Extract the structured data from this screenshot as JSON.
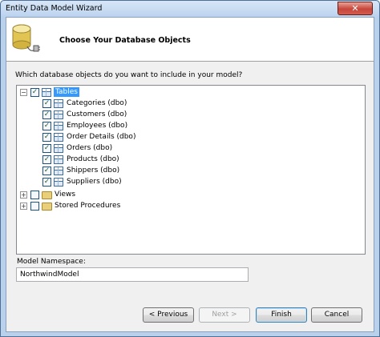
{
  "window": {
    "title": "Entity Data Model Wizard",
    "close_glyph": "✕"
  },
  "header": {
    "title": "Choose Your Database Objects",
    "icon": "database-plug-icon"
  },
  "prompt": "Which database objects do you want to include in your model?",
  "tree": {
    "tables_label": "Tables",
    "tables": [
      "Categories (dbo)",
      "Customers (dbo)",
      "Employees (dbo)",
      "Order Details (dbo)",
      "Orders (dbo)",
      "Products (dbo)",
      "Shippers (dbo)",
      "Suppliers (dbo)"
    ],
    "views_label": "Views",
    "procs_label": "Stored Procedures",
    "collapse_glyph": "−",
    "expand_glyph": "+",
    "check_glyph": "✓"
  },
  "namespace": {
    "label": "Model Namespace:",
    "value": "NorthwindModel"
  },
  "buttons": {
    "previous": "< Previous",
    "next": "Next >",
    "finish": "Finish",
    "cancel": "Cancel"
  },
  "colors": {
    "selection": "#3399ff",
    "title_bar": "#bcd3ee",
    "close_button": "#c7453a"
  }
}
